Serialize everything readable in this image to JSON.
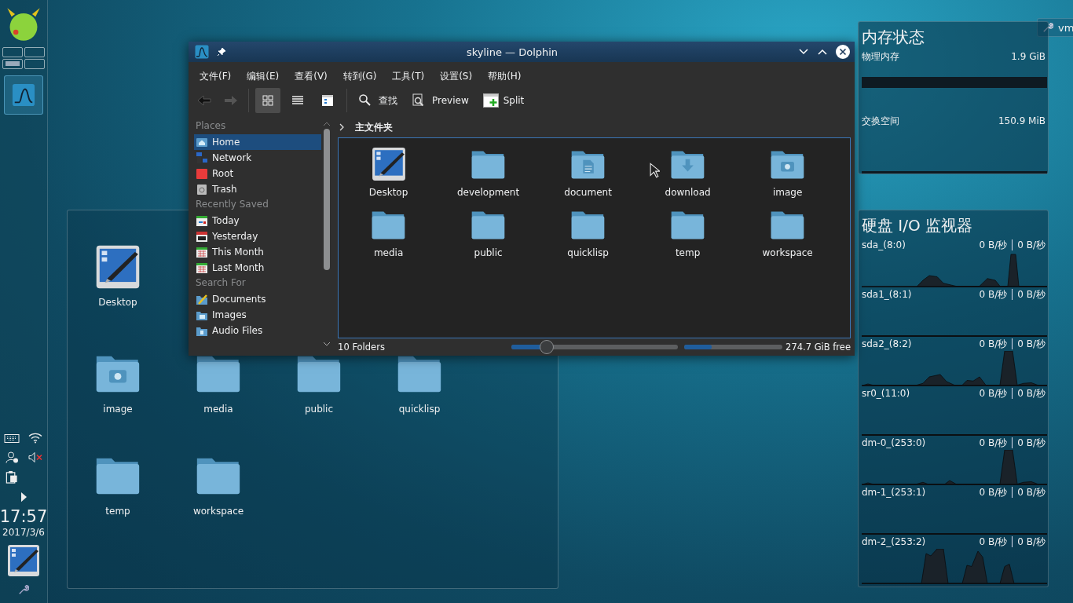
{
  "panel": {
    "clock": {
      "time": "17:57",
      "date": "2017/3/6"
    },
    "volume_muted": true
  },
  "desktop_folder": {
    "rows": [
      [
        {
          "label": "Desktop",
          "kind": "desktop"
        }
      ],
      [
        {
          "label": "image",
          "kind": "image"
        },
        {
          "label": "media",
          "kind": "folder"
        },
        {
          "label": "public",
          "kind": "folder"
        },
        {
          "label": "quicklisp",
          "kind": "folder"
        }
      ],
      [
        {
          "label": "temp",
          "kind": "folder"
        },
        {
          "label": "workspace",
          "kind": "folder"
        }
      ]
    ]
  },
  "dolphin": {
    "title": "skyline — Dolphin",
    "menu": [
      "文件(F)",
      "编辑(E)",
      "查看(V)",
      "转到(G)",
      "工具(T)",
      "设置(S)",
      "帮助(H)"
    ],
    "view_modes": [
      {
        "kind": "icons",
        "selected": true
      },
      {
        "kind": "details",
        "selected": false
      },
      {
        "kind": "compact",
        "selected": false
      }
    ],
    "actions": [
      {
        "kind": "search",
        "label": "查找"
      },
      {
        "kind": "preview",
        "label": "Preview"
      },
      {
        "kind": "split",
        "label": "Split"
      }
    ],
    "sidebar": [
      {
        "heading": "Places",
        "items": [
          {
            "label": "Home",
            "kind": "home",
            "selected": true
          },
          {
            "label": "Network",
            "kind": "network",
            "selected": false
          },
          {
            "label": "Root",
            "kind": "root",
            "selected": false
          },
          {
            "label": "Trash",
            "kind": "trash",
            "selected": false
          }
        ]
      },
      {
        "heading": "Recently Saved",
        "items": [
          {
            "label": "Today",
            "kind": "today",
            "selected": false
          },
          {
            "label": "Yesterday",
            "kind": "yesterday",
            "selected": false
          },
          {
            "label": "This Month",
            "kind": "month",
            "selected": false
          },
          {
            "label": "Last Month",
            "kind": "month",
            "selected": false
          }
        ]
      },
      {
        "heading": "Search For",
        "items": [
          {
            "label": "Documents",
            "kind": "documents",
            "selected": false
          },
          {
            "label": "Images",
            "kind": "images",
            "selected": false
          },
          {
            "label": "Audio Files",
            "kind": "audio",
            "selected": false
          }
        ]
      }
    ],
    "breadcrumb": "主文件夹",
    "files": [
      {
        "label": "Desktop",
        "kind": "desktop"
      },
      {
        "label": "development",
        "kind": "folder"
      },
      {
        "label": "document",
        "kind": "document"
      },
      {
        "label": "download",
        "kind": "download"
      },
      {
        "label": "image",
        "kind": "image"
      },
      {
        "label": "media",
        "kind": "folder"
      },
      {
        "label": "public",
        "kind": "folder"
      },
      {
        "label": "quicklisp",
        "kind": "folder"
      },
      {
        "label": "temp",
        "kind": "folder"
      },
      {
        "label": "workspace",
        "kind": "folder"
      }
    ],
    "status": {
      "count": "10 Folders",
      "zoom": {
        "level": 0.21
      },
      "space": {
        "level": 0.28
      },
      "free": "274.7 GiB free"
    }
  },
  "toolbox": {
    "label": "vm"
  },
  "memory": {
    "title": "内存状态",
    "rows": [
      {
        "label": "物理内存",
        "value": "1.9 GiB"
      },
      {
        "label": "交换空间",
        "value": "150.9 MiB"
      }
    ]
  },
  "disk_io": {
    "title": "硬盘 I/O 监视器",
    "rows": [
      {
        "label": "sda_(8:0)",
        "read": "0 B/秒",
        "write": "0 B/秒"
      },
      {
        "label": "sda1_(8:1)",
        "read": "0 B/秒",
        "write": "0 B/秒"
      },
      {
        "label": "sda2_(8:2)",
        "read": "0 B/秒",
        "write": "0 B/秒"
      },
      {
        "label": "sr0_(11:0)",
        "read": "0 B/秒",
        "write": "0 B/秒"
      },
      {
        "label": "dm-0_(253:0)",
        "read": "0 B/秒",
        "write": "0 B/秒"
      },
      {
        "label": "dm-1_(253:1)",
        "read": "0 B/秒",
        "write": "0 B/秒"
      },
      {
        "label": "dm-2_(253:2)",
        "read": "0 B/秒",
        "write": "0 B/秒"
      }
    ]
  }
}
